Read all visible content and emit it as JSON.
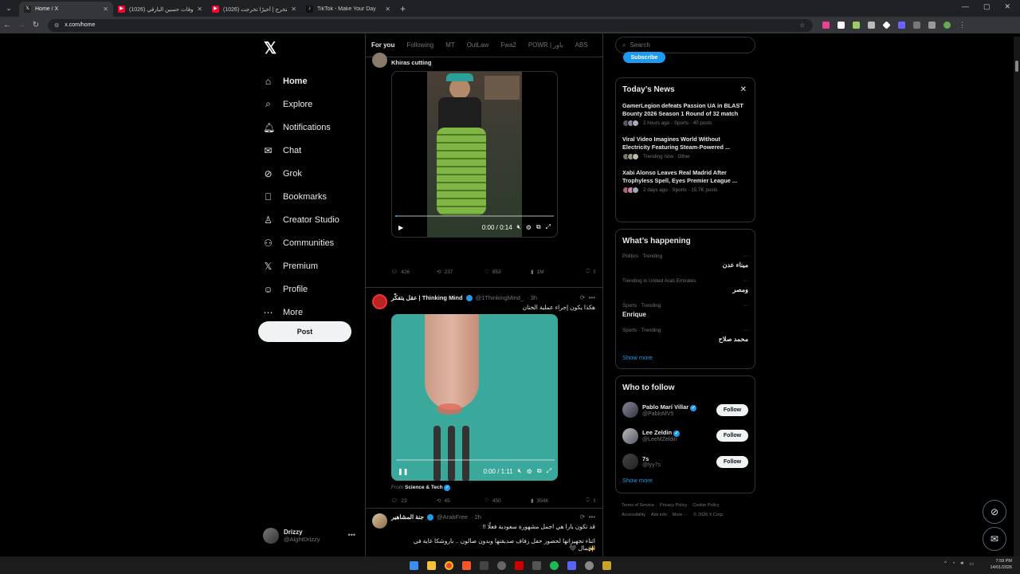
{
  "browser": {
    "tabs": [
      {
        "title": "Home / X",
        "color": "#222",
        "glyph": "𝕏",
        "active": true
      },
      {
        "title": "(1026) فلوقات حسين البارقي - ...",
        "color": "#ff0033",
        "glyph": "▶",
        "active": false
      },
      {
        "title": "(1026) فلوق التخرج | أخيرًا تخرجت",
        "color": "#ff0033",
        "glyph": "▶",
        "active": false
      },
      {
        "title": "TikTok - Make Your Day",
        "color": "#111",
        "glyph": "♪",
        "active": false
      }
    ],
    "url": "x.com/home"
  },
  "nav": {
    "items": [
      {
        "label": "Home",
        "icon": "⌂",
        "name": "home"
      },
      {
        "label": "Explore",
        "icon": "⌕",
        "name": "explore"
      },
      {
        "label": "Notifications",
        "icon": "🔔︎",
        "name": "notifications"
      },
      {
        "label": "Chat",
        "icon": "✉",
        "name": "chat"
      },
      {
        "label": "Grok",
        "icon": "⊘",
        "name": "grok"
      },
      {
        "label": "Bookmarks",
        "icon": "⎕",
        "name": "bookmarks"
      },
      {
        "label": "Creator Studio",
        "icon": "♙",
        "name": "creator-studio"
      },
      {
        "label": "Communities",
        "icon": "⚇",
        "name": "communities"
      },
      {
        "label": "Premium",
        "icon": "𝕏",
        "name": "premium"
      },
      {
        "label": "Profile",
        "icon": "☺",
        "name": "profile"
      },
      {
        "label": "More",
        "icon": "⋯",
        "name": "more"
      }
    ],
    "post_label": "Post",
    "account": {
      "name": "Drizzy",
      "handle": "@AlghtDrizzy"
    }
  },
  "feed": {
    "tabs": [
      "For you",
      "Following",
      "MT",
      "OutLaw",
      "Fwa2",
      "POWR | باور",
      "ABS"
    ],
    "tweet1": {
      "text": "Khiras cutting",
      "video_time": "0:00 / 0:14",
      "replies": "426",
      "reposts": "237",
      "likes": "853",
      "views": "1M"
    },
    "tweet2": {
      "name": "عقل يتفكّر | Thinking Mind",
      "handle": "@1ThinkingMind_",
      "time": "· 3h",
      "text": "هكذا يكون إجراء عملية الختان",
      "video_time": "0:00 / 1:11",
      "from_label": "From",
      "from_source": "Science & Tech",
      "replies": "23",
      "reposts": "45",
      "likes": "450",
      "views": "354K"
    },
    "tweet3": {
      "name": "جنة المشاهير",
      "handle": "@ArabFree",
      "time": "· 2h",
      "line1": "قد تكون يارا هي اجمل مشهورة سعودية فعلًا !!",
      "line2": "اثناء تجهيزاتها لحضور حفل زفاف صديقتها وبدون صالون .. باروشكا غاية في الجمال 🖤",
      "emoji": "✨",
      "emoji2": "🇸🇦👑"
    }
  },
  "right": {
    "search_placeholder": "Search",
    "subscribe_label": "Subscribe",
    "news_title": "Today’s News",
    "news": [
      {
        "headline": "GamerLegion defeats Passion UA in BLAST Bounty 2026 Season 1 Round of 32 match",
        "meta": "2 hours ago · Sports · 40 posts"
      },
      {
        "headline": "Viral Video Imagines World Without Electricity Featuring Steam-Powered ...",
        "meta": "Trending now · Other ·"
      },
      {
        "headline": "Xabi Alonso Leaves Real Madrid After Trophyless Spell, Eyes Premier League ...",
        "meta": "2 days ago · Sports · 15.7K posts"
      }
    ],
    "happening_title": "What’s happening",
    "trends": [
      {
        "context": "Politics · Trending",
        "topic": "ميناء عدن",
        "rtl": true
      },
      {
        "context": "Trending in United Arab Emirates",
        "topic": "ومصر",
        "rtl": true
      },
      {
        "context": "Sports · Trending",
        "topic": "Enrique",
        "rtl": false
      },
      {
        "context": "Sports · Trending",
        "topic": "محمد صلاح",
        "rtl": true
      }
    ],
    "show_more": "Show more",
    "wtf_title": "Who to follow",
    "follow_label": "Follow",
    "who_to_follow": [
      {
        "name": "Pablo Marí Villar",
        "handle": "@PabloMV5",
        "verified": true
      },
      {
        "name": "Lee Zeldin",
        "handle": "@LeeMZeldin",
        "verified": true
      },
      {
        "name": "7s",
        "handle": "@lyy7s",
        "verified": false
      }
    ],
    "footer": [
      "Terms of Service",
      "Privacy Policy",
      "Cookie Policy",
      "Accessibility",
      "Ads info",
      "More ···",
      "© 2026 X Corp."
    ]
  },
  "taskbar": {
    "time": "7:59 PM",
    "date": "14/01/2026"
  }
}
